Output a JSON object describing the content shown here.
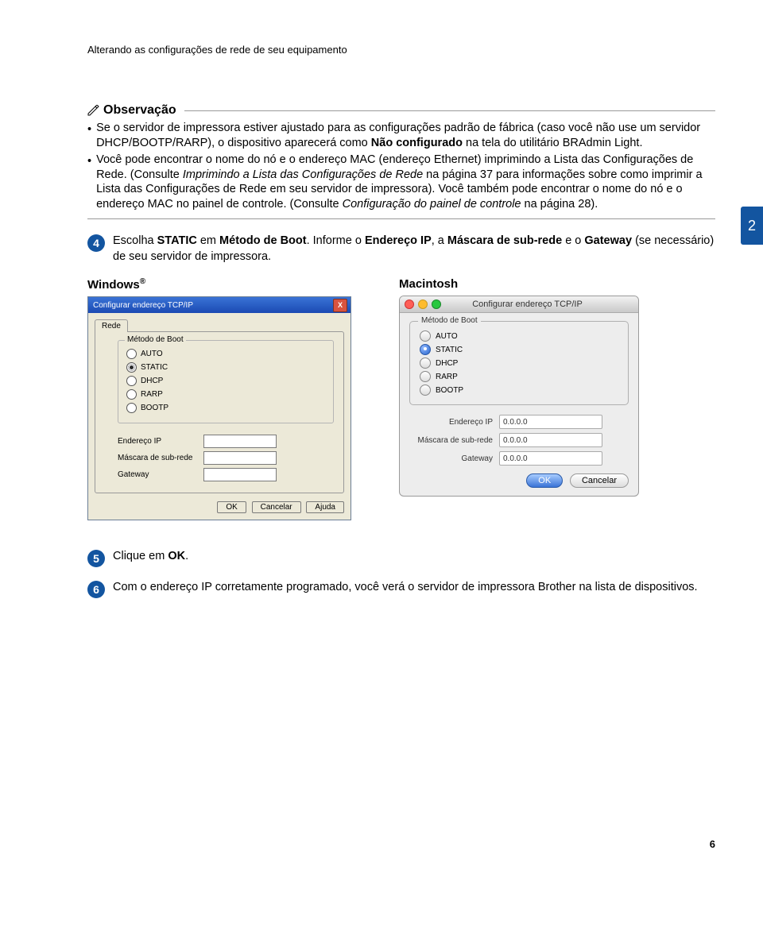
{
  "header": "Alterando as configurações de rede de seu equipamento",
  "sidebar_chapter": "2",
  "page_number": "6",
  "note": {
    "title": "Observação",
    "bullet_mark": "•",
    "b1_a": "Se o servidor de impressora estiver ajustado para as configurações padrão de fábrica (caso você não use um servidor DHCP/BOOTP/RARP), o dispositivo aparecerá como ",
    "b1_b": "Não configurado",
    "b1_c": " na tela do utilitário BRAdmin Light.",
    "b2_a": "Você pode encontrar o nome do nó e o endereço MAC (endereço Ethernet) imprimindo a Lista das Configurações de Rede. (Consulte ",
    "b2_b": "Imprimindo a Lista das Configurações de Rede",
    "b2_c": " na página 37 para informações sobre como imprimir a Lista das Configurações de Rede em seu servidor de impressora). Você também pode encontrar o nome do nó e o endereço MAC no painel de controle. (Consulte ",
    "b2_d": "Configuração do painel de controle",
    "b2_e": " na página 28)."
  },
  "steps": {
    "s4": {
      "num": "4",
      "a": "Escolha ",
      "b": "STATIC",
      "c": " em ",
      "d": "Método de Boot",
      "e": ". Informe o ",
      "f": "Endereço IP",
      "g": ", a ",
      "h": "Máscara de sub-rede",
      "i": " e o ",
      "j": "Gateway",
      "k": " (se necessário) de seu servidor de impressora."
    },
    "s5": {
      "num": "5",
      "a": "Clique em ",
      "b": "OK",
      "c": "."
    },
    "s6": {
      "num": "6",
      "text": "Com o endereço IP corretamente programado, você verá o servidor de impressora Brother na lista de dispositivos."
    }
  },
  "columns": {
    "win_title": "Windows",
    "win_reg": "®",
    "mac_title": "Macintosh"
  },
  "win": {
    "titlebar": "Configurar endereço TCP/IP",
    "tab": "Rede",
    "group": "Método de Boot",
    "opt_auto": "AUTO",
    "opt_static": "STATIC",
    "opt_dhcp": "DHCP",
    "opt_rarp": "RARP",
    "opt_bootp": "BOOTP",
    "ip_label": "Endereço IP",
    "mask_label": "Máscara de sub-rede",
    "gw_label": "Gateway",
    "btn_ok": "OK",
    "btn_cancel": "Cancelar",
    "btn_help": "Ajuda"
  },
  "mac": {
    "titlebar": "Configurar endereço TCP/IP",
    "group": "Método de Boot",
    "opt_auto": "AUTO",
    "opt_static": "STATIC",
    "opt_dhcp": "DHCP",
    "opt_rarp": "RARP",
    "opt_bootp": "BOOTP",
    "ip_label": "Endereço IP",
    "mask_label": "Máscara de sub-rede",
    "gw_label": "Gateway",
    "ip_value": "0.0.0.0",
    "mask_value": "0.0.0.0",
    "gw_value": "0.0.0.0",
    "btn_ok": "OK",
    "btn_cancel": "Cancelar"
  }
}
